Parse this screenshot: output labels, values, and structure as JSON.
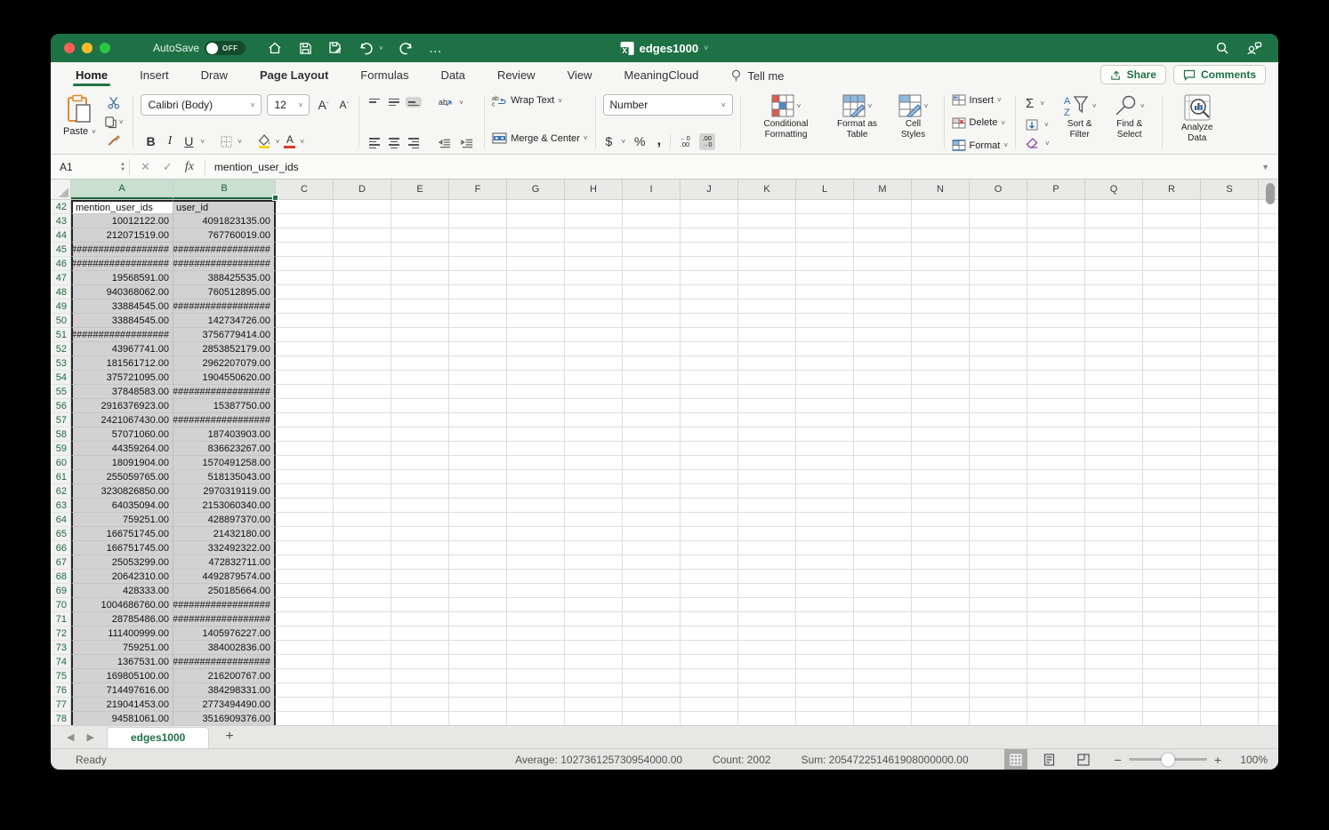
{
  "colors": {
    "titlebar_green": "#1e7145",
    "accent_green": "#217346",
    "selection_grey": "#d2d2d2",
    "traffic_red": "#ff5f57",
    "traffic_yellow": "#febc2e",
    "traffic_green": "#28c840"
  },
  "titlebar": {
    "autosave_label": "AutoSave",
    "autosave_state": "OFF",
    "doc_title": "edges1000"
  },
  "menubar": {
    "tabs": [
      "Home",
      "Insert",
      "Draw",
      "Page Layout",
      "Formulas",
      "Data",
      "Review",
      "View",
      "MeaningCloud"
    ],
    "active_tab": "Home",
    "bold_tabs": [
      "Home",
      "Page Layout"
    ],
    "tellme_label": "Tell me",
    "share_label": "Share",
    "comments_label": "Comments"
  },
  "ribbon": {
    "paste_label": "Paste",
    "font_name": "Calibri (Body)",
    "font_size": "12",
    "bold_label": "B",
    "italic_label": "I",
    "underline_label": "U",
    "wrap_text_label": "Wrap Text",
    "merge_center_label": "Merge & Center",
    "number_format_value": "Number",
    "dollar_label": "$",
    "percent_label": "%",
    "comma_label": ",",
    "conditional_formatting_label": "Conditional Formatting",
    "format_as_table_label": "Format as Table",
    "cell_styles_label": "Cell Styles",
    "insert_label": "Insert",
    "delete_label": "Delete",
    "format_label": "Format",
    "autosum_label": "Σ",
    "sort_filter_label": "Sort & Filter",
    "find_select_label": "Find & Select",
    "analyze_data_label": "Analyze Data"
  },
  "formulabar": {
    "cell_ref": "A1",
    "fx_label": "fx",
    "value": "mention_user_ids"
  },
  "grid": {
    "col_letters": [
      "A",
      "B",
      "C",
      "D",
      "E",
      "F",
      "G",
      "H",
      "I",
      "J",
      "K",
      "L",
      "M",
      "N",
      "O",
      "P",
      "Q",
      "R",
      "S"
    ],
    "selected_columns": [
      "A",
      "B"
    ],
    "hash_overflow": "##################",
    "rows": [
      {
        "n": 42,
        "a": "mention_user_ids",
        "b": "user_id"
      },
      {
        "n": 43,
        "a": "10012122.00",
        "b": "4091823135.00"
      },
      {
        "n": 44,
        "a": "212071519.00",
        "b": "767760019.00"
      },
      {
        "n": 45,
        "a": "##################",
        "b": "##################"
      },
      {
        "n": 46,
        "a": "##################",
        "b": "##################"
      },
      {
        "n": 47,
        "a": "19568591.00",
        "b": "388425535.00"
      },
      {
        "n": 48,
        "a": "940368062.00",
        "b": "760512895.00"
      },
      {
        "n": 49,
        "a": "33884545.00",
        "b": "##################"
      },
      {
        "n": 50,
        "a": "33884545.00",
        "b": "142734726.00"
      },
      {
        "n": 51,
        "a": "##################",
        "b": "3756779414.00"
      },
      {
        "n": 52,
        "a": "43967741.00",
        "b": "2853852179.00"
      },
      {
        "n": 53,
        "a": "181561712.00",
        "b": "2962207079.00"
      },
      {
        "n": 54,
        "a": "375721095.00",
        "b": "1904550620.00"
      },
      {
        "n": 55,
        "a": "37848583.00",
        "b": "##################"
      },
      {
        "n": 56,
        "a": "2916376923.00",
        "b": "15387750.00"
      },
      {
        "n": 57,
        "a": "2421067430.00",
        "b": "##################"
      },
      {
        "n": 58,
        "a": "57071060.00",
        "b": "187403903.00"
      },
      {
        "n": 59,
        "a": "44359264.00",
        "b": "836623267.00"
      },
      {
        "n": 60,
        "a": "18091904.00",
        "b": "1570491258.00"
      },
      {
        "n": 61,
        "a": "255059765.00",
        "b": "518135043.00"
      },
      {
        "n": 62,
        "a": "3230826850.00",
        "b": "2970319119.00"
      },
      {
        "n": 63,
        "a": "64035094.00",
        "b": "2153060340.00"
      },
      {
        "n": 64,
        "a": "759251.00",
        "b": "428897370.00"
      },
      {
        "n": 65,
        "a": "166751745.00",
        "b": "21432180.00"
      },
      {
        "n": 66,
        "a": "166751745.00",
        "b": "332492322.00"
      },
      {
        "n": 67,
        "a": "25053299.00",
        "b": "472832711.00"
      },
      {
        "n": 68,
        "a": "20642310.00",
        "b": "4492879574.00"
      },
      {
        "n": 69,
        "a": "428333.00",
        "b": "250185664.00"
      },
      {
        "n": 70,
        "a": "1004686760.00",
        "b": "##################"
      },
      {
        "n": 71,
        "a": "28785486.00",
        "b": "##################"
      },
      {
        "n": 72,
        "a": "111400999.00",
        "b": "1405976227.00"
      },
      {
        "n": 73,
        "a": "759251.00",
        "b": "384002836.00"
      },
      {
        "n": 74,
        "a": "1367531.00",
        "b": "##################"
      },
      {
        "n": 75,
        "a": "169805100.00",
        "b": "216200767.00"
      },
      {
        "n": 76,
        "a": "714497616.00",
        "b": "384298331.00"
      },
      {
        "n": 77,
        "a": "219041453.00",
        "b": "2773494490.00"
      },
      {
        "n": 78,
        "a": "94581061.00",
        "b": "3516909376.00"
      }
    ]
  },
  "sheetbar": {
    "tab_label": "edges1000",
    "add_label": "+"
  },
  "statusbar": {
    "ready_label": "Ready",
    "average": "Average: 102736125730954000.00",
    "count": "Count: 2002",
    "sum": "Sum: 205472251461908000000.00",
    "zoom_level": "100%"
  }
}
